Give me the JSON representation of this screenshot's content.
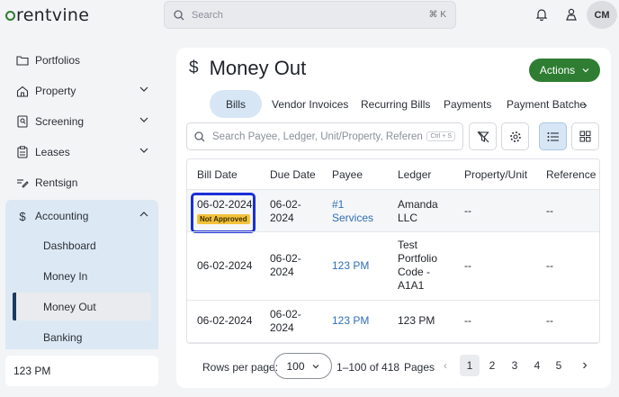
{
  "app": {
    "logo_text": "rentvine"
  },
  "search": {
    "placeholder": "Search",
    "shortcut": "⌘ K"
  },
  "user": {
    "initials": "CM"
  },
  "sidebar": {
    "items": [
      {
        "label": "Portfolios",
        "icon": "folder-icon"
      },
      {
        "label": "Property",
        "icon": "house-icon"
      },
      {
        "label": "Screening",
        "icon": "screening-icon"
      },
      {
        "label": "Leases",
        "icon": "clipboard-icon"
      },
      {
        "label": "Rentsign",
        "icon": "signature-icon"
      },
      {
        "label": "Accounting",
        "icon": "dollar-icon"
      }
    ],
    "accounting_sub": [
      {
        "label": "Dashboard"
      },
      {
        "label": "Money In"
      },
      {
        "label": "Money Out"
      },
      {
        "label": "Banking"
      }
    ],
    "selected_property": "123 PM"
  },
  "page": {
    "title": "Money Out",
    "title_icon": "$",
    "actions_label": "Actions",
    "tabs": [
      {
        "label": "Bills"
      },
      {
        "label": "Vendor Invoices"
      },
      {
        "label": "Recurring Bills"
      },
      {
        "label": "Payments"
      },
      {
        "label": "Payment Batche"
      }
    ],
    "table_search": {
      "placeholder": "Search Payee, Ledger, Unit/Property, Reference,",
      "shortcut": "Ctrl + S"
    }
  },
  "table": {
    "headers": [
      "Bill Date",
      "Due Date",
      "Payee",
      "Ledger",
      "Property/Unit",
      "Reference"
    ],
    "rows": [
      {
        "bill_date": "06-02-2024",
        "status": "Not Approved",
        "due_date_1": "06-02-",
        "due_date_2": "2024",
        "payee_1": "#1",
        "payee_2": "Services",
        "ledger_1": "Amanda",
        "ledger_2": "LLC",
        "ledger_3": "",
        "ledger_4": "",
        "property": "--",
        "reference": "--"
      },
      {
        "bill_date": "06-02-2024",
        "status": "",
        "due_date_1": "06-02-",
        "due_date_2": "2024",
        "payee_1": "123 PM",
        "payee_2": "",
        "ledger_1": "Test",
        "ledger_2": "Portfolio",
        "ledger_3": "Code -",
        "ledger_4": "A1A1",
        "property": "--",
        "reference": "--"
      },
      {
        "bill_date": "06-02-2024",
        "status": "",
        "due_date_1": "06-02-",
        "due_date_2": "2024",
        "payee_1": "123 PM",
        "payee_2": "",
        "ledger_1": "123 PM",
        "ledger_2": "",
        "ledger_3": "",
        "ledger_4": "",
        "property": "--",
        "reference": "--"
      }
    ]
  },
  "pagination": {
    "rows_per_page_label": "Rows per page:",
    "rows_per_page": "100",
    "range_text": "1–100 of 418",
    "pages_label": "Pages",
    "pages": [
      "1",
      "2",
      "3",
      "4",
      "5"
    ],
    "current_page": "1"
  },
  "colors": {
    "brand_green": "#2e7d32",
    "active_blue": "#d7e6f5",
    "link": "#2f6fb5",
    "badge": "#f3c23a",
    "highlight": "#1b2fd9"
  }
}
